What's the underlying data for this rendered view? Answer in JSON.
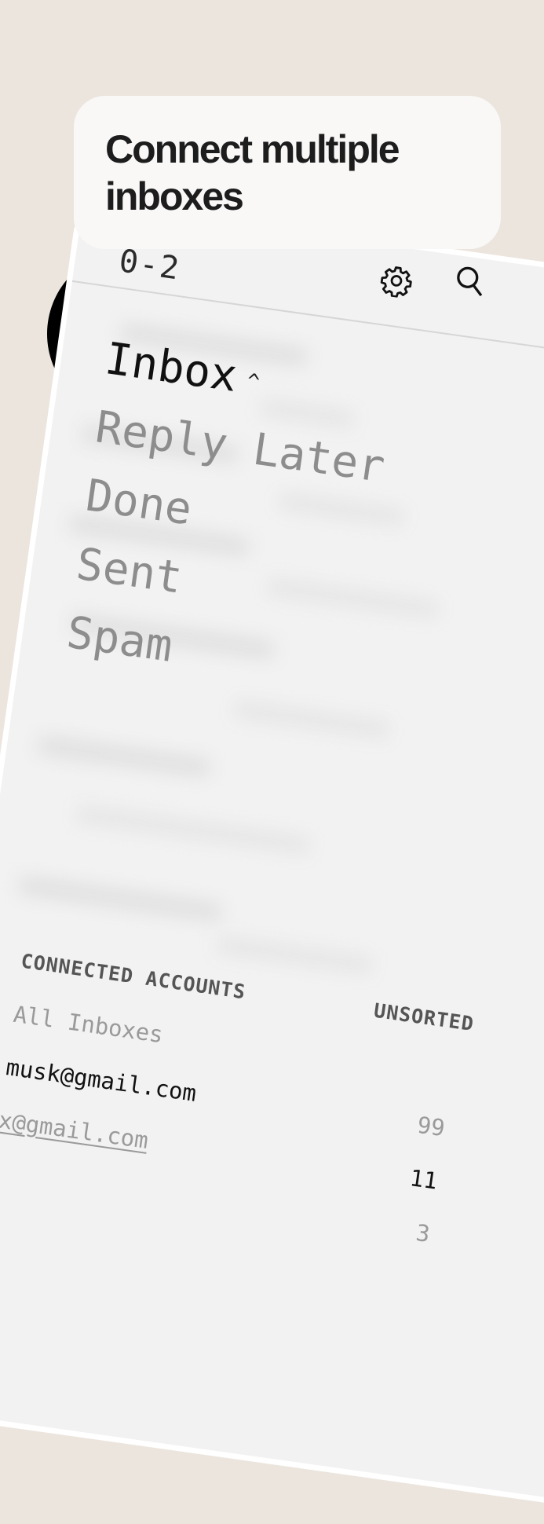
{
  "callout": {
    "title": "Connect multiple inboxes"
  },
  "header": {
    "counter_text": "0-2",
    "icons": [
      "gear-icon",
      "search-icon"
    ]
  },
  "folders": [
    {
      "label": "Inbox",
      "active": true,
      "caret": "^"
    },
    {
      "label": "Reply Later",
      "active": false
    },
    {
      "label": "Done",
      "active": false
    },
    {
      "label": "Sent",
      "active": false
    },
    {
      "label": "Spam",
      "active": false
    }
  ],
  "accounts": {
    "header": "CONNECTED ACCOUNTS",
    "unsorted_label": "UNSORTED",
    "items": [
      {
        "label": "All Inboxes",
        "count": ""
      },
      {
        "label": "musk@gmail.com",
        "count": "99",
        "selected": true
      },
      {
        "label": "x@gmail.com",
        "count": "11"
      },
      {
        "label": "",
        "count": "3"
      }
    ]
  },
  "colors": {
    "background": "#ece5de",
    "phone_screen": "#f2f2f2",
    "callout_bg": "#f9f8f7",
    "ring": "#000000"
  }
}
